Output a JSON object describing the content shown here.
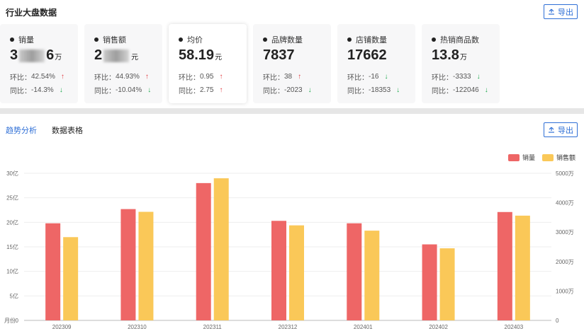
{
  "header": {
    "title": "行业大盘数据",
    "export_label": "导出"
  },
  "cards": [
    {
      "label": "销量",
      "value_prefix": "3",
      "value_suffix": "6",
      "unit": "万",
      "masked": true,
      "mom_label": "环比：",
      "mom_value": "42.54%",
      "mom_dir": "up",
      "yoy_label": "同比：",
      "yoy_value": "-14.3%",
      "yoy_dir": "down"
    },
    {
      "label": "销售额",
      "value_prefix": "2",
      "value_suffix": "",
      "unit": "元",
      "masked": true,
      "mom_label": "环比：",
      "mom_value": "44.93%",
      "mom_dir": "up",
      "yoy_label": "同比：",
      "yoy_value": "-10.04%",
      "yoy_dir": "down"
    },
    {
      "label": "均价",
      "value_prefix": "58.19",
      "value_suffix": "",
      "unit": "元",
      "masked": false,
      "active": true,
      "mom_label": "环比：",
      "mom_value": "0.95",
      "mom_dir": "up",
      "yoy_label": "同比：",
      "yoy_value": "2.75",
      "yoy_dir": "up"
    },
    {
      "label": "品牌数量",
      "value_prefix": "7837",
      "value_suffix": "",
      "unit": "",
      "masked": false,
      "mom_label": "环比：",
      "mom_value": "38",
      "mom_dir": "up",
      "yoy_label": "同比：",
      "yoy_value": "-2023",
      "yoy_dir": "down"
    },
    {
      "label": "店铺数量",
      "value_prefix": "17662",
      "value_suffix": "",
      "unit": "",
      "masked": false,
      "mom_label": "环比：",
      "mom_value": "-16",
      "mom_dir": "down",
      "yoy_label": "同比：",
      "yoy_value": "-18353",
      "yoy_dir": "down"
    },
    {
      "label": "热销商品数",
      "value_prefix": "13.8",
      "value_suffix": "",
      "unit": "万",
      "masked": false,
      "mom_label": "环比：",
      "mom_value": "-3333",
      "mom_dir": "down",
      "yoy_label": "同比：",
      "yoy_value": "-122046",
      "yoy_dir": "down"
    }
  ],
  "arrows": {
    "up": "↑",
    "down": "↓"
  },
  "tabs": [
    {
      "label": "趋势分析",
      "active": true
    },
    {
      "label": "数据表格",
      "active": false
    }
  ],
  "trend_export_label": "导出",
  "colors": {
    "accent": "#2f6fd6",
    "sales_volume": "#ee6666",
    "sales_amount": "#fac858",
    "up": "#e0393e",
    "down": "#1aa84a"
  },
  "chart_data": {
    "type": "bar",
    "categories": [
      "202309",
      "202310",
      "202311",
      "202312",
      "202401",
      "202402",
      "202403"
    ],
    "series": [
      {
        "name": "销量",
        "axis": "left",
        "color": "#ee6666",
        "values": [
          19.8,
          22.7,
          28.0,
          20.3,
          19.8,
          15.5,
          22.1
        ]
      },
      {
        "name": "销售额",
        "axis": "right",
        "color": "#fac858",
        "values": [
          2830,
          3690,
          4830,
          3230,
          3050,
          2450,
          3560
        ]
      }
    ],
    "y_left": {
      "ticks": [
        "0",
        "5亿",
        "10亿",
        "15亿",
        "20亿",
        "25亿",
        "30亿"
      ],
      "min": 0,
      "max": 30
    },
    "y_right": {
      "ticks": [
        "0",
        "1000万",
        "2000万",
        "3000万",
        "4000万",
        "5000万"
      ],
      "min": 0,
      "max": 5000
    },
    "xlabel_corner": "月份",
    "legend": "top-right",
    "grid": true
  }
}
